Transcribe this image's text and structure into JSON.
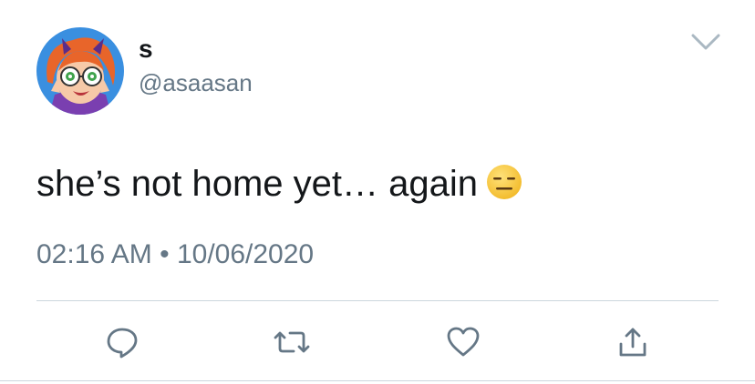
{
  "author": {
    "display_name": "s",
    "handle": "@asaasan"
  },
  "tweet": {
    "text": "she’s not home yet… again",
    "emoji": "expressionless-face-emoji",
    "time": "02:16 AM",
    "separator": "•",
    "date": "10/06/2020"
  },
  "actions": {
    "reply_icon": "reply-icon",
    "retweet_icon": "retweet-icon",
    "like_icon": "heart-icon",
    "share_icon": "share-icon"
  },
  "colors": {
    "primary_text": "#14171a",
    "secondary_text": "#657786",
    "icon": "#657786",
    "divider": "#ccd6dd",
    "avatar_background": "#3a8fe0",
    "avatar_hair": "#e8652a",
    "emoji_face": "#f9c83a"
  }
}
